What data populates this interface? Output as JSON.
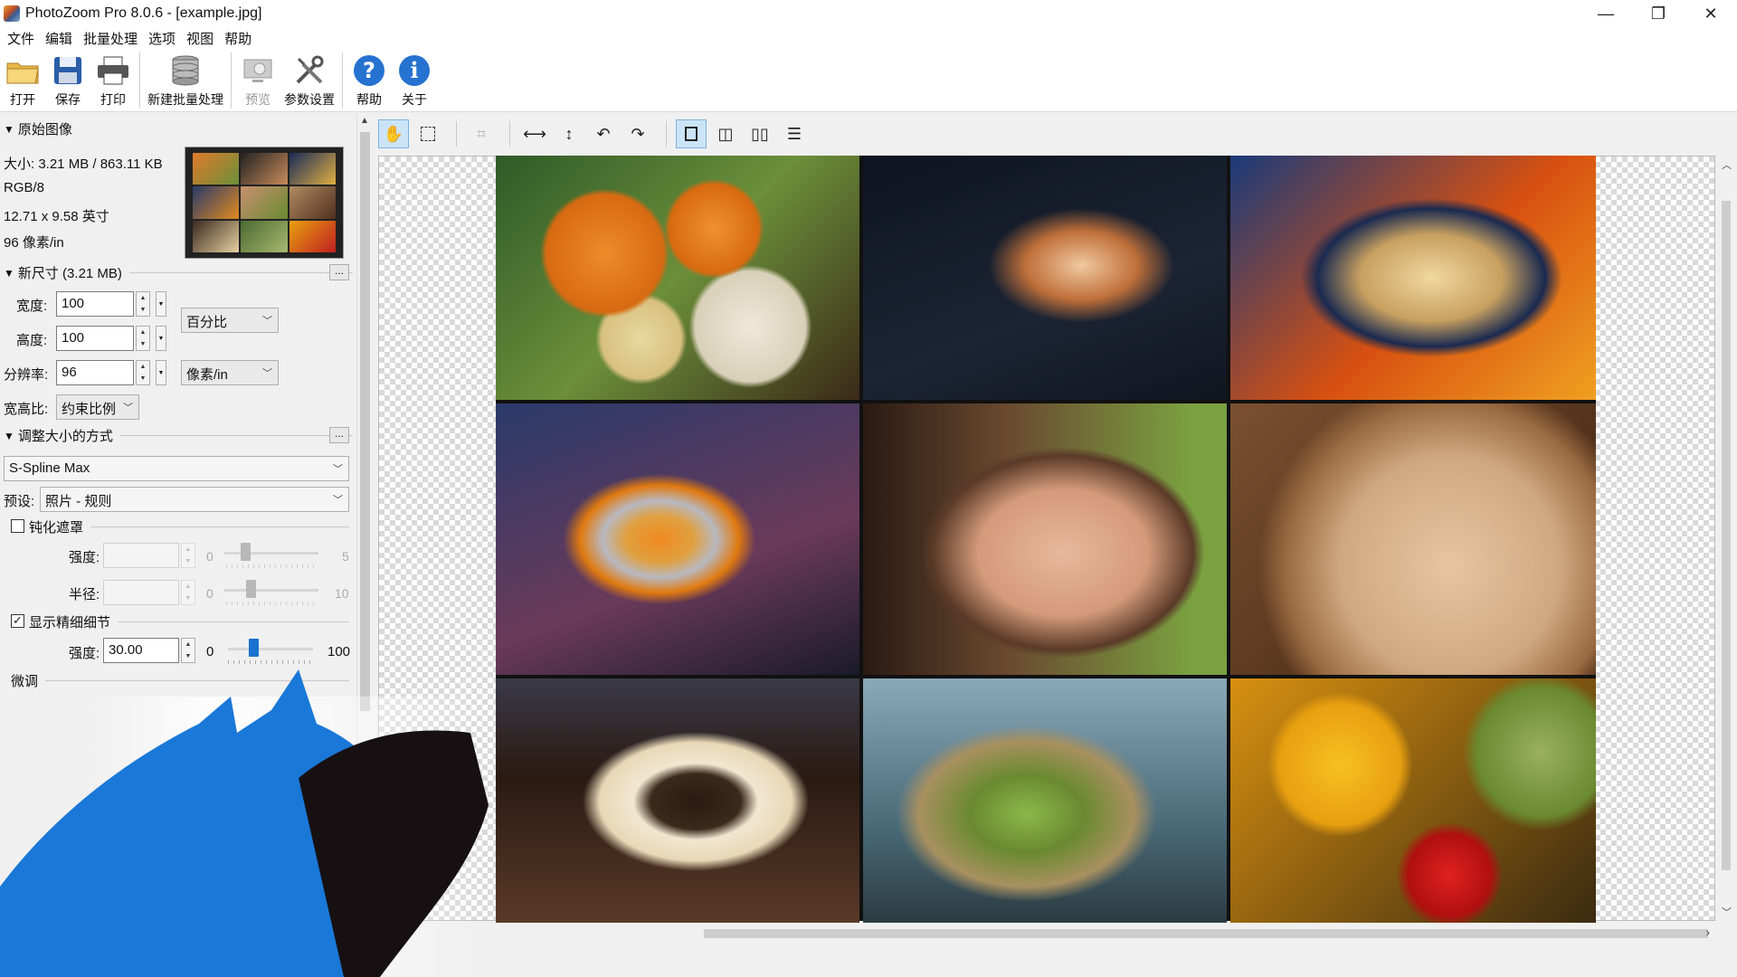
{
  "window": {
    "title": "PhotoZoom Pro 8.0.6 - [example.jpg]",
    "controls": {
      "minimize": "—",
      "restore": "❐",
      "close": "✕"
    }
  },
  "menu": [
    "文件",
    "编辑",
    "批量处理",
    "选项",
    "视图",
    "帮助"
  ],
  "toolbar": {
    "open": "打开",
    "save": "保存",
    "print": "打印",
    "new_batch": "新建批量处理",
    "preview": "预览",
    "settings": "参数设置",
    "help": "帮助",
    "about": "关于"
  },
  "original": {
    "header": "原始图像",
    "size": "大小: 3.21 MB / 863.11 KB",
    "mode": "RGB/8",
    "dimensions": "12.71 x 9.58 英寸",
    "resolution": "96 像素/in"
  },
  "new_size": {
    "header": "新尺寸 (3.21 MB)",
    "width_label": "宽度:",
    "width_value": "100",
    "height_label": "高度:",
    "height_value": "100",
    "unit": "百分比",
    "res_label": "分辨率:",
    "res_value": "96",
    "res_unit": "像素/in",
    "aspect_label": "宽高比:",
    "aspect_value": "约束比例"
  },
  "resize_method": {
    "header": "调整大小的方式",
    "method": "S-Spline Max",
    "preset_label": "预设:",
    "preset_value": "照片 - 规则"
  },
  "unsharp": {
    "label": "钝化遮罩",
    "checked": false,
    "strength_label": "强度:",
    "strength_min": "0",
    "strength_max": "5",
    "radius_label": "半径:",
    "radius_min": "0",
    "radius_max": "10"
  },
  "fine_detail": {
    "label": "显示精细细节",
    "checked": true,
    "strength_label": "强度:",
    "strength_value": "30.00",
    "min": "0",
    "max": "100",
    "level": 0.3
  },
  "tuning": {
    "header": "微调"
  },
  "image_tools": [
    "hand-tool",
    "select-tool",
    "crop-tool",
    "fit-width",
    "fit-height",
    "rotate-left",
    "rotate-right",
    "view-single",
    "view-split-vertical",
    "view-side-by-side",
    "view-split-horizontal"
  ],
  "colors": {
    "accent": "#1a73d0",
    "toolbar_active": "#cce4f7"
  }
}
